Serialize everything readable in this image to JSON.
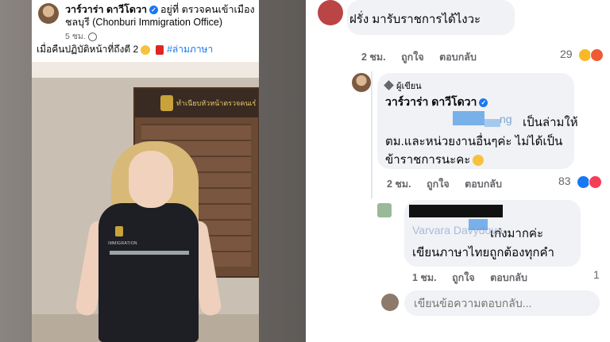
{
  "post": {
    "author": "วาร์วาร่า ดาวีโดวา",
    "location": "อยู่ที่ ตรวจคนเข้าเมืองชลบุรี (Chonburi Immigration Office)",
    "time": "5 ชม.",
    "text": "เมื่อคืนปฏิบัติหน้าที่ถึงตี 2",
    "hashtag": "#ล่ามภาษา",
    "photo": {
      "board_title": "ทำเนียบหัวหน้าตรวจคนเข้าเมือง",
      "vest_label": "IMMIGRATION"
    }
  },
  "comments": {
    "top": {
      "text": "ฝรั่ง มารับราชการได้ไงวะ",
      "time": "2 ชม.",
      "like": "ถูกใจ",
      "reply": "ตอบกลับ",
      "reactions": "29"
    },
    "author_reply": {
      "tag": "ผู้เขียน",
      "name": "วาร์วาร่า ดาวีโดวา",
      "mention_tail": "ng",
      "line1": "เป็นล่ามให้",
      "line2": "ตม.และหน่วยงานอื่นๆค่ะ ไม่ได้เป็น",
      "line3": "ข้าราชการนะคะ",
      "time": "2 ชม.",
      "like": "ถูกใจ",
      "reply": "ตอบกลับ",
      "reactions": "83"
    },
    "nested_reply": {
      "mention": "Varvara Davydova",
      "line1": "เก่งมากค่ะ",
      "line2": "เขียนภาษาไทยถูกต้องทุกคำ",
      "time": "1 ชม.",
      "like": "ถูกใจ",
      "reply": "ตอบกลับ",
      "reactions": "1"
    },
    "input_placeholder": "เขียนข้อความตอบกลับ..."
  }
}
